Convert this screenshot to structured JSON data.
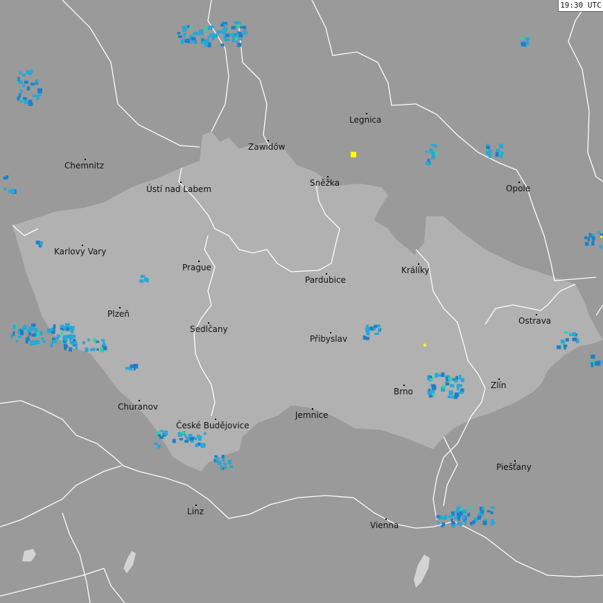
{
  "map": {
    "timestamp": "19:30 UTC",
    "colors": {
      "outside": "#9a9a9a",
      "region": "#b1b1b1",
      "border": "#ffffff",
      "radar_light": "#2aa7d6",
      "radar_mid": "#1f7fc8",
      "radar_strong": "#2fd1a6",
      "lightning": "#ffff00",
      "lake": "#d3d3d3"
    },
    "cities": [
      {
        "name": "Chemnitz"
      },
      {
        "name": "Zawidów"
      },
      {
        "name": "Legnica"
      },
      {
        "name": "Ústí nad Labem"
      },
      {
        "name": "Sněžka"
      },
      {
        "name": "Opole"
      },
      {
        "name": "Karlovy Vary"
      },
      {
        "name": "Prague"
      },
      {
        "name": "Králíky"
      },
      {
        "name": "Pardubice"
      },
      {
        "name": "Plzeň"
      },
      {
        "name": "Ostrava"
      },
      {
        "name": "Sedlčany"
      },
      {
        "name": "Přibyslav"
      },
      {
        "name": "Zlín"
      },
      {
        "name": "Brno"
      },
      {
        "name": "Churanov"
      },
      {
        "name": "Jemnice"
      },
      {
        "name": "České Budějovice"
      },
      {
        "name": "Piešťany"
      },
      {
        "name": "Linz"
      },
      {
        "name": "Vienna"
      }
    ]
  }
}
